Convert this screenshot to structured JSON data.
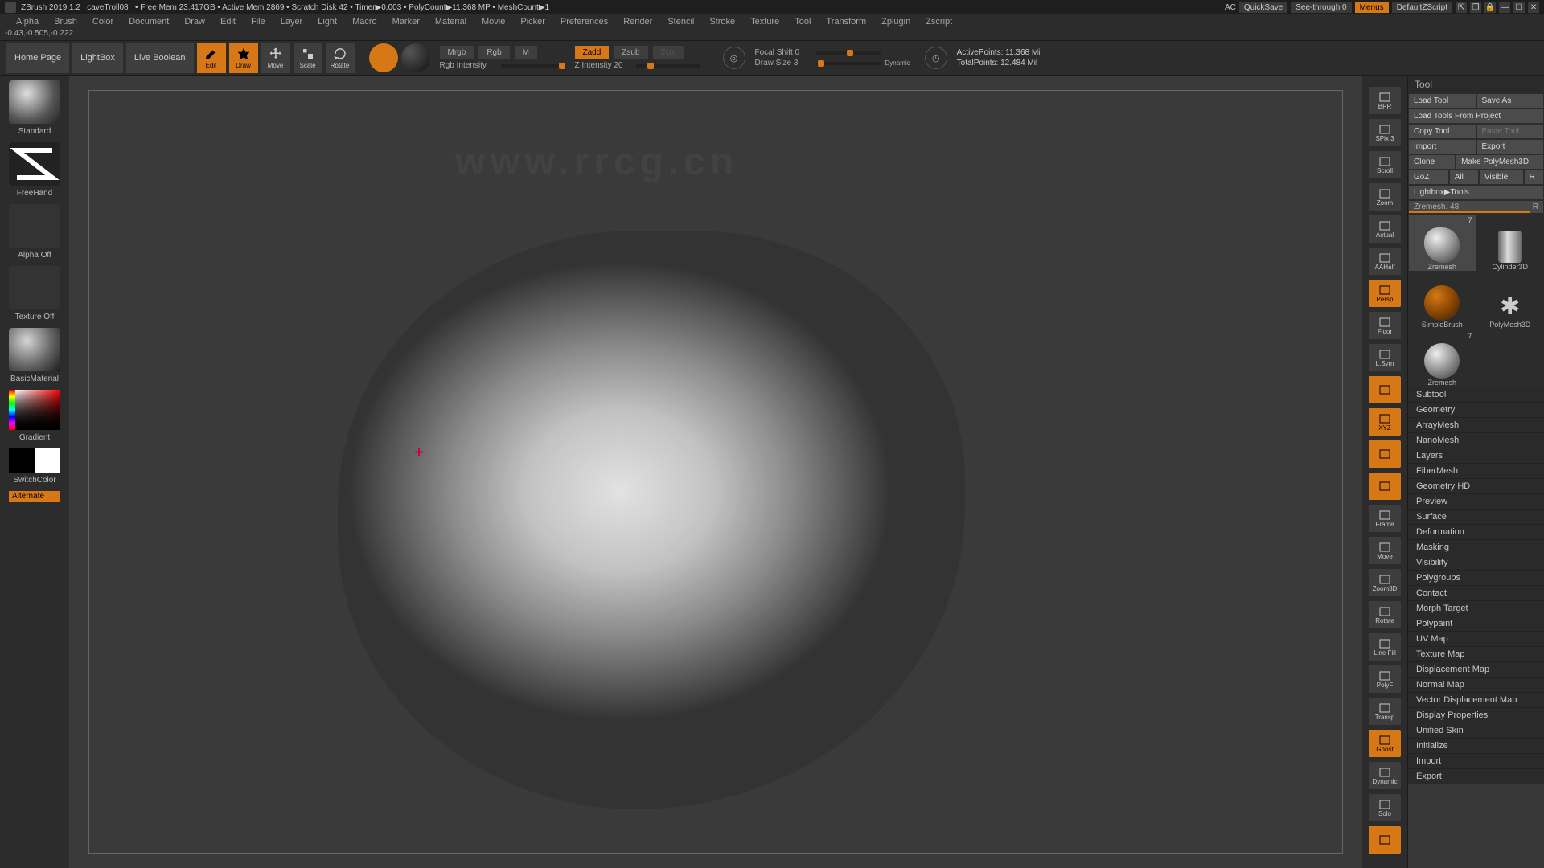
{
  "title": {
    "app": "ZBrush 2019.1.2",
    "doc": "caveTroll08",
    "freemem": "Free Mem 23.417GB",
    "activemem": "Active Mem 2869",
    "scratch": "Scratch Disk 42",
    "timer": "Timer▶0.003",
    "poly": "PolyCount▶11.368 MP",
    "mesh": "MeshCount▶1",
    "ac": "AC",
    "quicksave": "QuickSave",
    "seethrough": "See-through  0",
    "menus": "Menus",
    "defaultscript": "DefaultZScript"
  },
  "menus": [
    "Alpha",
    "Brush",
    "Color",
    "Document",
    "Draw",
    "Edit",
    "File",
    "Layer",
    "Light",
    "Macro",
    "Marker",
    "Material",
    "Movie",
    "Picker",
    "Preferences",
    "Render",
    "Stencil",
    "Stroke",
    "Texture",
    "Tool",
    "Transform",
    "Zplugin",
    "Zscript"
  ],
  "status_coords": "-0.43,-0.505,-0.222",
  "toolbar": {
    "homepage": "Home Page",
    "lightbox": "LightBox",
    "liveboolean": "Live Boolean",
    "edit": "Edit",
    "draw": "Draw",
    "move": "Move",
    "scale": "Scale",
    "rotate": "Rotate",
    "mrgb": "Mrgb",
    "rgb": "Rgb",
    "m": "M",
    "rgb_intensity_label": "Rgb Intensity",
    "zadd": "Zadd",
    "zsub": "Zsub",
    "zcut": "Zcut",
    "zintensity_label": "Z Intensity 20",
    "focal_label": "Focal Shift 0",
    "drawsize_label": "Draw Size 3",
    "dynamic": "Dynamic",
    "active_pts": "ActivePoints: 11.368 Mil",
    "total_pts": "TotalPoints: 12.484 Mil"
  },
  "left": {
    "brush_name": "Standard",
    "stroke_name": "FreeHand",
    "alpha": "Alpha Off",
    "texture": "Texture Off",
    "material": "BasicMaterial",
    "gradient": "Gradient",
    "switchcolor": "SwitchColor",
    "alternate": "Alternate"
  },
  "rightshelf": [
    "BPR",
    "SPix 3",
    "Scroll",
    "Zoom",
    "Actual",
    "AAHalf",
    "Persp",
    "Floor",
    "L.Sym",
    "",
    "XYZ",
    "",
    "",
    "Frame",
    "Move",
    "Zoom3D",
    "Rotate",
    "Line Fill",
    "PolyF",
    "Transp",
    "Ghost",
    "Dynamic",
    "Solo",
    ""
  ],
  "rightshelf_orange": [
    "Persp",
    "",
    "XYZ",
    "Ghost"
  ],
  "tool": {
    "header": "Tool",
    "buttons": {
      "loadtool": "Load Tool",
      "saveas": "Save As",
      "loadproject": "Load Tools From Project",
      "copytool": "Copy Tool",
      "pastetool": "Paste Tool",
      "import": "Import",
      "export": "Export",
      "clone": "Clone",
      "makepm3d": "Make PolyMesh3D",
      "goz": "GoZ",
      "all": "All",
      "visible": "Visible",
      "r": "R",
      "lightbox_tools": "Lightbox▶Tools",
      "zremesh": "Zremesh. 48",
      "r2": "R"
    },
    "thumbs": [
      {
        "name": "Zremesh",
        "badge": "7",
        "sel": true
      },
      {
        "name": "Cylinder3D",
        "badge": ""
      },
      {
        "name": "SimpleBrush",
        "badge": ""
      },
      {
        "name": "PolyMesh3D",
        "badge": ""
      },
      {
        "name": "Zremesh",
        "badge": "7"
      }
    ],
    "sections": [
      "Subtool",
      "Geometry",
      "ArrayMesh",
      "NanoMesh",
      "Layers",
      "FiberMesh",
      "Geometry HD",
      "Preview",
      "Surface",
      "Deformation",
      "Masking",
      "Visibility",
      "Polygroups",
      "Contact",
      "Morph Target",
      "Polypaint",
      "UV Map",
      "Texture Map",
      "Displacement Map",
      "Normal Map",
      "Vector Displacement Map",
      "Display Properties",
      "Unified Skin",
      "Initialize",
      "Import",
      "Export"
    ]
  }
}
